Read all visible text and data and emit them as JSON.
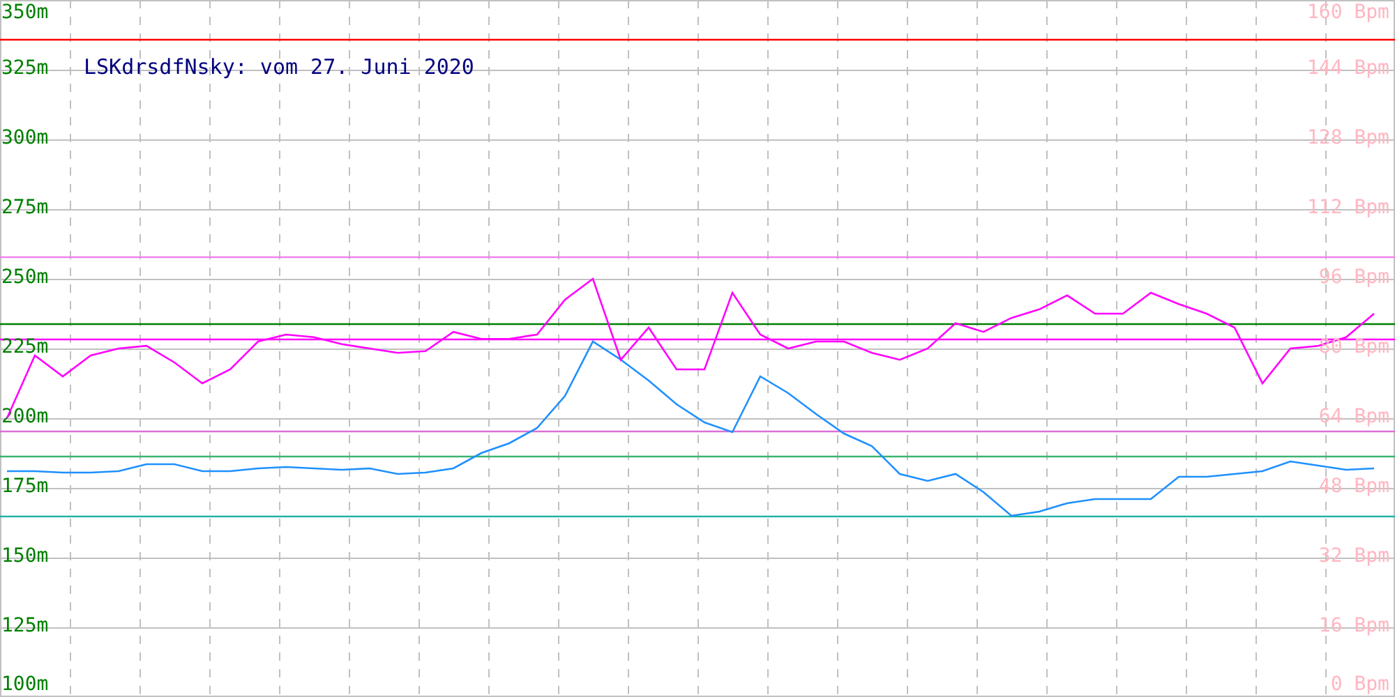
{
  "charts": [
    {
      "chart_data": {
        "type": "line",
        "title": "LSKdrsdfNsky: vom 27. Juni 2020",
        "categories": [
          null,
          null,
          null,
          null,
          null,
          null,
          null,
          null,
          null,
          null,
          null,
          null,
          null,
          null,
          null,
          null,
          null,
          null,
          null,
          null,
          null,
          null,
          null,
          null,
          null,
          null,
          null,
          null,
          null,
          null,
          null,
          null,
          null,
          null,
          null,
          null,
          null,
          null,
          null,
          null,
          null,
          null,
          null,
          null,
          null,
          null,
          null,
          null,
          null,
          null
        ],
        "ylim": [
          100,
          350
        ],
        "grid": true,
        "yticks": [
          {
            "value": 350,
            "label": "350m"
          },
          {
            "value": 325,
            "label": "325m"
          },
          {
            "value": 300,
            "label": "300m"
          },
          {
            "value": 275,
            "label": "275m"
          },
          {
            "value": 250,
            "label": "250m"
          },
          {
            "value": 225,
            "label": "225m"
          },
          {
            "value": 200,
            "label": "200m"
          },
          {
            "value": 175,
            "label": "175m"
          },
          {
            "value": 150,
            "label": "150m"
          },
          {
            "value": 125,
            "label": "125m"
          },
          {
            "value": 100,
            "label": "100m"
          }
        ],
        "series": [
          {
            "color": "#1e90ff",
            "values": [
              181,
              181,
              180.5,
              180.5,
              181,
              183.5,
              183.5,
              181,
              181,
              182,
              182.5,
              182,
              181.5,
              182,
              180,
              180.5,
              182,
              187.5,
              191,
              196.5,
              208,
              227.5,
              221,
              213.5,
              205,
              198.5,
              195,
              215,
              209,
              201.5,
              194.5,
              190,
              180,
              177.5,
              180,
              173.5,
              165,
              166.5,
              169.5,
              171,
              171,
              171,
              179,
              179,
              180,
              181,
              184.5,
              183,
              181.5,
              182
            ]
          }
        ],
        "ref_lines": [
          {
            "axis": "y",
            "value": 336,
            "color": "#ff0000"
          },
          {
            "axis": "y",
            "value": 258,
            "color": "#ee82ee"
          },
          {
            "axis": "y",
            "value": 234,
            "color": "#008000"
          },
          {
            "axis": "y",
            "value": 228.5,
            "color": "#ff00ff"
          },
          {
            "axis": "y",
            "value": 195.5,
            "color": "#da70d6"
          },
          {
            "axis": "y",
            "value": 186.5,
            "color": "#3cb371"
          },
          {
            "axis": "y",
            "value": 165,
            "color": "#20b2aa"
          }
        ]
      }
    },
    {
      "chart_data": {
        "type": "line",
        "categories": [
          null,
          null,
          null,
          null,
          null,
          null,
          null,
          null,
          null,
          null,
          null,
          null,
          null,
          null,
          null,
          null,
          null,
          null,
          null,
          null,
          null,
          null,
          null,
          null,
          null,
          null,
          null,
          null,
          null,
          null,
          null,
          null,
          null,
          null,
          null,
          null,
          null,
          null,
          null,
          null,
          null,
          null,
          null,
          null,
          null,
          null,
          null,
          null,
          null,
          null
        ],
        "ylim": [
          0,
          160
        ],
        "yticks": [
          {
            "value": 160,
            "label": "160 Bpm"
          },
          {
            "value": 144,
            "label": "144 Bpm"
          },
          {
            "value": 128,
            "label": "128 Bpm"
          },
          {
            "value": 112,
            "label": "112 Bpm"
          },
          {
            "value": 96,
            "label": "96 Bpm"
          },
          {
            "value": 80,
            "label": "80 Bpm"
          },
          {
            "value": 64,
            "label": "64 Bpm"
          },
          {
            "value": 48,
            "label": "48 Bpm"
          },
          {
            "value": 32,
            "label": "32 Bpm"
          },
          {
            "value": 16,
            "label": "16 Bpm"
          },
          {
            "value": 0,
            "label": "0 Bpm"
          }
        ],
        "series": [
          {
            "color": "#ff00ff",
            "values": [
              64,
              78.4,
              73.6,
              78.4,
              80,
              80.6,
              76.8,
              72,
              75.2,
              81.6,
              83.2,
              82.6,
              81,
              80,
              79,
              79.4,
              83.8,
              82.2,
              82.2,
              83.2,
              91.2,
              96,
              77.4,
              84.8,
              75.2,
              75.2,
              92.8,
              83.2,
              80,
              81.6,
              81.6,
              79,
              77.4,
              80,
              85.8,
              83.8,
              87,
              89,
              92.2,
              88,
              88,
              92.8,
              90.2,
              88,
              84.8,
              72,
              80,
              80.6,
              82.6,
              88
            ]
          }
        ]
      }
    }
  ]
}
